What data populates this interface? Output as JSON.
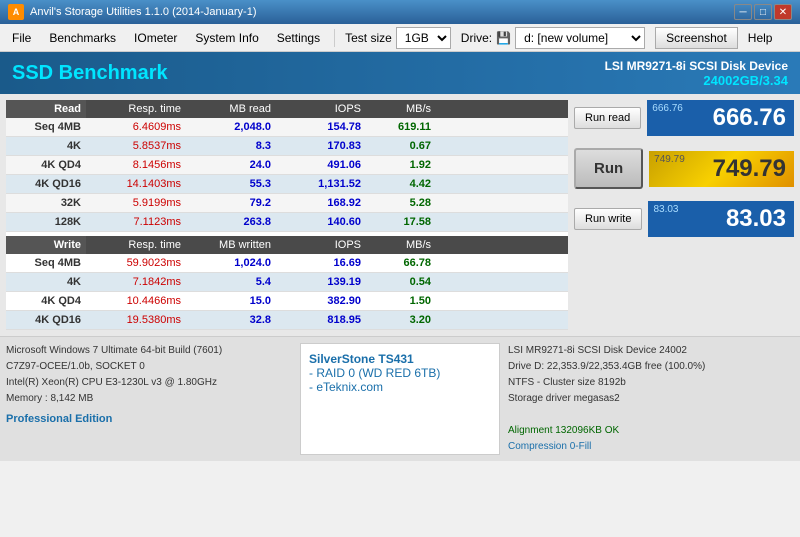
{
  "titleBar": {
    "title": "Anvil's Storage Utilities 1.1.0 (2014-January-1)",
    "icon": "A",
    "controls": [
      "minimize",
      "maximize",
      "close"
    ]
  },
  "menuBar": {
    "items": [
      "File",
      "Benchmarks",
      "IOmeter",
      "System Info",
      "Settings"
    ],
    "testSizeLabel": "Test size",
    "testSizeValue": "1GB",
    "driveLabel": "Drive:",
    "driveIcon": "💾",
    "driveValue": "d: [new volume]",
    "screenshotBtn": "Screenshot",
    "helpBtn": "Help"
  },
  "header": {
    "title": "SSD Benchmark",
    "deviceName": "LSI MR9271-8i SCSI Disk Device",
    "deviceSize": "24002GB/3.34"
  },
  "readTable": {
    "headers": [
      "Read",
      "Resp. time",
      "MB read",
      "IOPS",
      "MB/s"
    ],
    "rows": [
      {
        "label": "Seq 4MB",
        "resp": "6.4609ms",
        "mb": "2,048.0",
        "iops": "154.78",
        "mbs": "619.11"
      },
      {
        "label": "4K",
        "resp": "5.8537ms",
        "mb": "8.3",
        "iops": "170.83",
        "mbs": "0.67"
      },
      {
        "label": "4K QD4",
        "resp": "8.1456ms",
        "mb": "24.0",
        "iops": "491.06",
        "mbs": "1.92"
      },
      {
        "label": "4K QD16",
        "resp": "14.1403ms",
        "mb": "55.3",
        "iops": "1,131.52",
        "mbs": "4.42"
      },
      {
        "label": "32K",
        "resp": "5.9199ms",
        "mb": "79.2",
        "iops": "168.92",
        "mbs": "5.28"
      },
      {
        "label": "128K",
        "resp": "7.1123ms",
        "mb": "263.8",
        "iops": "140.60",
        "mbs": "17.58"
      }
    ]
  },
  "writeTable": {
    "headers": [
      "Write",
      "Resp. time",
      "MB written",
      "IOPS",
      "MB/s"
    ],
    "rows": [
      {
        "label": "Seq 4MB",
        "resp": "59.9023ms",
        "mb": "1,024.0",
        "iops": "16.69",
        "mbs": "66.78"
      },
      {
        "label": "4K",
        "resp": "7.1842ms",
        "mb": "5.4",
        "iops": "139.19",
        "mbs": "0.54"
      },
      {
        "label": "4K QD4",
        "resp": "10.4466ms",
        "mb": "15.0",
        "iops": "382.90",
        "mbs": "1.50"
      },
      {
        "label": "4K QD16",
        "resp": "19.5380ms",
        "mb": "32.8",
        "iops": "818.95",
        "mbs": "3.20"
      }
    ]
  },
  "scores": {
    "readLabel": "666.76",
    "readValue": "666.76",
    "runLabel": "749.79",
    "runValue": "749.79",
    "writeLabel": "83.03",
    "writeValue": "83.03",
    "runReadBtn": "Run read",
    "runBtn": "Run",
    "runWriteBtn": "Run write"
  },
  "bottomInfo": {
    "sysInfo": [
      "Microsoft Windows 7 Ultimate  64-bit Build (7601)",
      "C7Z97-OCEE/1.0b, SOCKET 0",
      "Intel(R) Xeon(R) CPU E3-1230L v3 @ 1.80GHz",
      "Memory : 8,142 MB"
    ],
    "proEdition": "Professional Edition",
    "promo": {
      "brand": "SilverStone TS431",
      "line2": "- RAID 0 (WD RED 6TB)",
      "line3": "- eTeknix.com"
    },
    "deviceRight": {
      "line1": "LSI MR9271-8i SCSI Disk Device 24002",
      "line2": "Drive D:  22,353.9/22,353.4GB free (100.0%)",
      "line3": "NTFS - Cluster size 8192b",
      "line4": "Storage driver  megasas2",
      "line5": "",
      "line6": "Alignment 132096KB OK",
      "line7": "Compression 0-Fill"
    }
  }
}
